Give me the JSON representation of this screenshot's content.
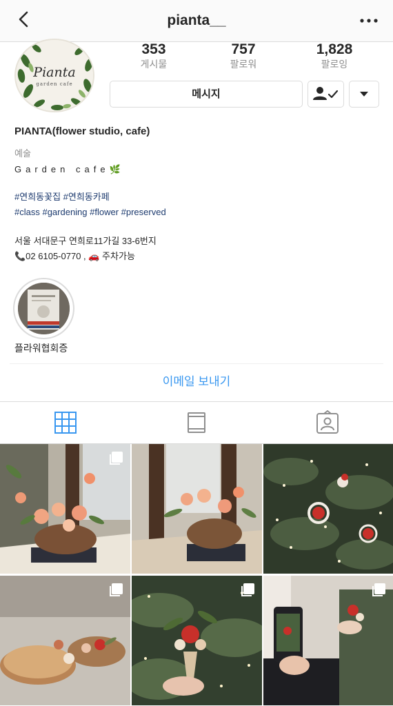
{
  "header": {
    "username": "pianta__"
  },
  "profile": {
    "stats": [
      {
        "value": "353",
        "label": "게시물"
      },
      {
        "value": "757",
        "label": "팔로워"
      },
      {
        "value": "1,828",
        "label": "팔로잉"
      }
    ],
    "message_label": "메시지",
    "avatar_logo_text": "Pianta",
    "avatar_logo_sub": "garden cafe"
  },
  "bio": {
    "name": "PIANTA(flower studio, cafe)",
    "category": "예술",
    "tagline": "Garden cafe🌿",
    "hashtags_line1": "#연희동꽃집 #연희동카페",
    "hashtags_line2": "#class #gardening #flower #preserved",
    "address": "서울 서대문구 연희로11가길 33-6번지",
    "phone_line": "📞02 6105-0770 , 🚗 주차가능"
  },
  "highlight": {
    "label": "플라워협회증"
  },
  "email_button": "이메일 보내기",
  "colors": {
    "link": "#3897f0",
    "hashtag": "#1c3a6e",
    "tab_active": "#3897f0",
    "tab_inactive": "#8e8e8e"
  },
  "icons": [
    "back-chevron-icon",
    "more-dots-icon",
    "person-check-icon",
    "caret-down-icon",
    "grid-icon",
    "feed-icon",
    "tagged-icon",
    "multi-photo-icon"
  ]
}
